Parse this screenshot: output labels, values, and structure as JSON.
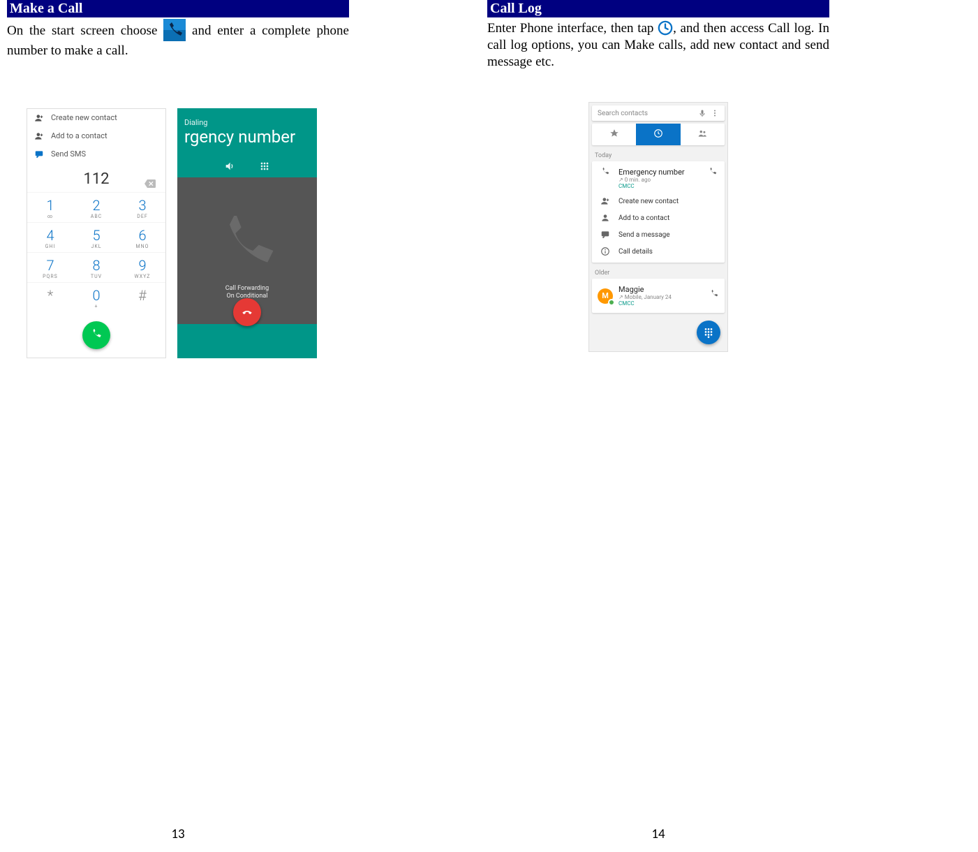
{
  "left": {
    "heading": "Make a Call",
    "body_before_icon": "On the start screen choose",
    "body_after_icon": "and enter a complete phone number to make a call.",
    "page_number": "13",
    "dialer": {
      "actions": [
        {
          "icon": "person-add-icon",
          "label": "Create new contact"
        },
        {
          "icon": "person-add-icon",
          "label": "Add to a contact"
        },
        {
          "icon": "message-icon",
          "label": "Send SMS"
        }
      ],
      "typed_number": "112",
      "keys": [
        {
          "d": "1",
          "l": "∞"
        },
        {
          "d": "2",
          "l": "ABC"
        },
        {
          "d": "3",
          "l": "DEF"
        },
        {
          "d": "4",
          "l": "GHI"
        },
        {
          "d": "5",
          "l": "JKL"
        },
        {
          "d": "6",
          "l": "MNO"
        },
        {
          "d": "7",
          "l": "PQRS"
        },
        {
          "d": "8",
          "l": "TUV"
        },
        {
          "d": "9",
          "l": "WXYZ"
        },
        {
          "d": "*",
          "l": ""
        },
        {
          "d": "0",
          "l": "+"
        },
        {
          "d": "#",
          "l": ""
        }
      ]
    },
    "incall": {
      "status": "Dialing",
      "title": "rgency number",
      "forwarding_line1": "Call Forwarding",
      "forwarding_line2": "On Conditional"
    }
  },
  "right": {
    "heading": "Call Log",
    "body_before_icon": "Enter Phone interface, then tap",
    "body_after_icon": ", and then access Call log. In call log options, you can Make calls, add new contact and send message etc.",
    "page_number": "14",
    "calllog": {
      "search_placeholder": "Search contacts",
      "section_today": "Today",
      "entry": {
        "title": "Emergency number",
        "subtitle": "↗ 0 min. ago",
        "carrier": "CMCC"
      },
      "options": [
        {
          "icon": "person-add-icon",
          "label": "Create new contact"
        },
        {
          "icon": "person-icon",
          "label": "Add to a contact"
        },
        {
          "icon": "message-icon",
          "label": "Send a message"
        },
        {
          "icon": "info-icon",
          "label": "Call details"
        }
      ],
      "section_older": "Older",
      "older_entry": {
        "avatar_letter": "M",
        "title": "Maggie",
        "subtitle": "↗ Mobile, January 24",
        "carrier": "CMCC"
      }
    }
  }
}
